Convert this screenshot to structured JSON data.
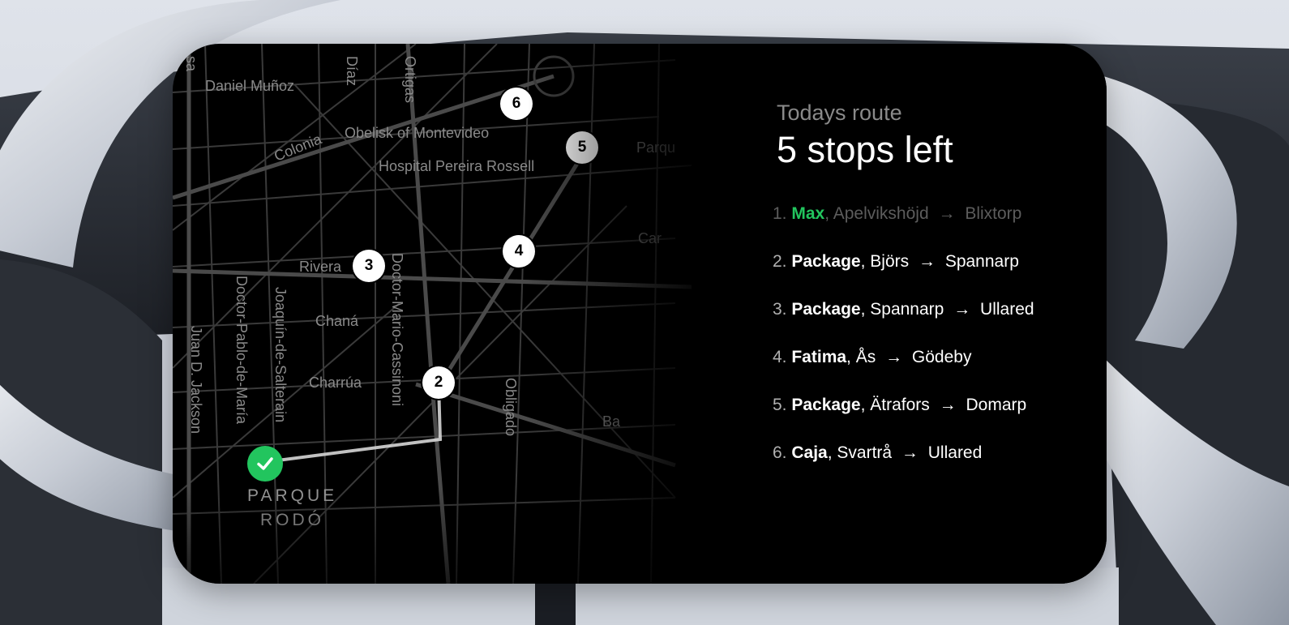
{
  "header": {
    "subtitle": "Todays route",
    "title": "5 stops left"
  },
  "map": {
    "labels": [
      "Daniel Muñoz",
      "sa",
      "Díaz",
      "Ortigas",
      "Colonia",
      "Obelisk of Montevideo",
      "Hospital Pereira Rossell",
      "Parqu",
      "Car",
      "Rivera",
      "Doctor-Mario-Cassinoni",
      "Chaná",
      "Joaquín-de-Salterain",
      "Doctor-Pablo-de-María",
      "Juan D. Jackson",
      "Charrúa",
      "Obligado",
      "Ba",
      "PARQUE",
      "RODÓ"
    ],
    "markers": [
      "6",
      "5",
      "4",
      "3",
      "2"
    ],
    "completed_color": "#22c55e"
  },
  "stops": [
    {
      "num": "1.",
      "kind": "Max",
      "from": "Apelvikshöjd",
      "to": "Blixtorp",
      "status": "done"
    },
    {
      "num": "2.",
      "kind": "Package",
      "from": "Björs",
      "to": "Spannarp",
      "status": "pending"
    },
    {
      "num": "3.",
      "kind": "Package",
      "from": "Spannarp",
      "to": "Ullared",
      "status": "pending"
    },
    {
      "num": "4.",
      "kind": "Fatima",
      "from": "Ås",
      "to": "Gödeby",
      "status": "pending"
    },
    {
      "num": "5.",
      "kind": "Package",
      "from": "Ätrafors",
      "to": "Domarp",
      "status": "pending"
    },
    {
      "num": "6.",
      "kind": "Caja",
      "from": "Svartrå",
      "to": "Ullared",
      "status": "pending"
    }
  ],
  "icons": {
    "check": "check-icon",
    "arrow": "→"
  }
}
